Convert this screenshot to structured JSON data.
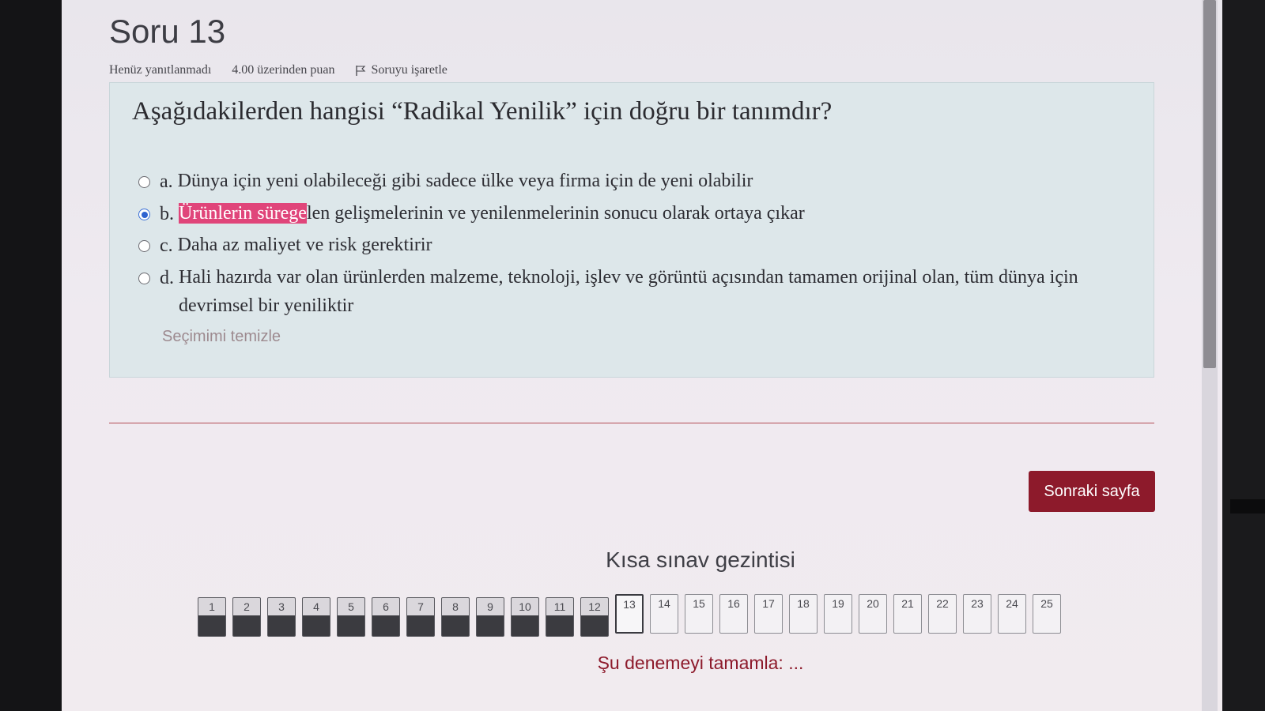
{
  "question": {
    "title": "Soru 13",
    "status": "Henüz yanıtlanmadı",
    "points": "4.00 üzerinden puan",
    "flag_label": "Soruyu işaretle",
    "text": "Aşağıdakilerden hangisi “Radikal Yenilik” için doğru bir tanımdır?",
    "options": [
      {
        "letter": "a.",
        "pre": "",
        "highlight": "",
        "rest": "Dünya için yeni olabileceği gibi sadece ülke veya firma için de yeni olabilir",
        "selected": false
      },
      {
        "letter": "b.",
        "pre": "",
        "highlight": "Ürünlerin sürege",
        "rest": "len gelişmelerinin ve yenilenmelerinin sonucu olarak ortaya çıkar",
        "selected": true
      },
      {
        "letter": "c.",
        "pre": "",
        "highlight": "",
        "rest": "Daha az maliyet ve risk gerektirir",
        "selected": false
      },
      {
        "letter": "d.",
        "pre": "",
        "highlight": "",
        "rest": "Hali hazırda var olan ürünlerden malzeme, teknoloji, işlev ve görüntü açısından tamamen orijinal olan, tüm dünya için devrimsel bir yeniliktir",
        "selected": false
      }
    ],
    "clear_label": "Seçimimi temizle"
  },
  "next_button": "Sonraki sayfa",
  "quiz_nav": {
    "title": "Kısa sınav gezintisi",
    "current": 13,
    "answered_count": 12,
    "buttons": [
      "1",
      "2",
      "3",
      "4",
      "5",
      "6",
      "7",
      "8",
      "9",
      "10",
      "11",
      "12",
      "13",
      "14",
      "15",
      "16",
      "17",
      "18",
      "19",
      "20",
      "21",
      "22",
      "23",
      "24",
      "25"
    ],
    "finish_label": "Şu denemeyi tamamla: ..."
  },
  "colors": {
    "primary": "#8d1a2b",
    "highlight": "#e0457a",
    "radio_selected": "#2e62d0"
  }
}
